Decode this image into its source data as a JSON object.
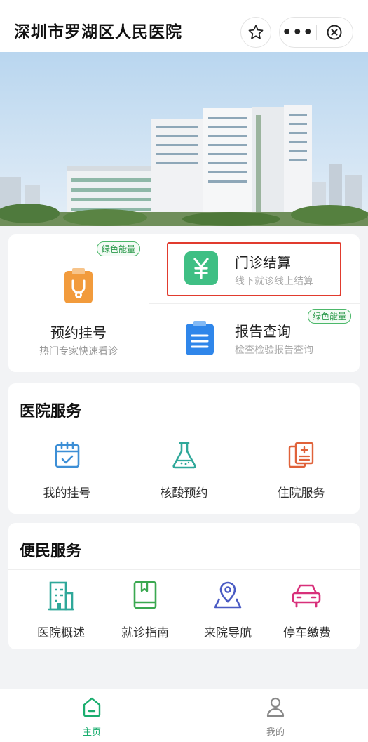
{
  "header": {
    "title": "深圳市罗湖区人民医院",
    "star_icon": "star-icon",
    "more_label": "•••",
    "close_icon": "close-circle-icon"
  },
  "top_card": {
    "appointment": {
      "label": "预约挂号",
      "sub": "热门专家快速看诊",
      "tag": "绿色能量",
      "icon": "clipboard-stethoscope-icon"
    },
    "payment": {
      "label": "门诊结算",
      "sub": "线下就诊线上结算",
      "icon": "yen-icon"
    },
    "report": {
      "label": "报告查询",
      "sub": "检查检验报告查询",
      "tag": "绿色能量",
      "icon": "report-list-icon"
    }
  },
  "hospital_services": {
    "title": "医院服务",
    "items": [
      {
        "label": "我的挂号",
        "icon": "calendar-check-icon"
      },
      {
        "label": "核酸预约",
        "icon": "flask-icon"
      },
      {
        "label": "住院服务",
        "icon": "medical-record-icon"
      }
    ]
  },
  "convenience_services": {
    "title": "便民服务",
    "items": [
      {
        "label": "医院概述",
        "icon": "building-icon"
      },
      {
        "label": "就诊指南",
        "icon": "guide-book-icon"
      },
      {
        "label": "来院导航",
        "icon": "map-pin-icon"
      },
      {
        "label": "停车缴费",
        "icon": "car-icon"
      }
    ]
  },
  "tabbar": {
    "tabs": [
      {
        "label": "主页",
        "icon": "home-icon",
        "active": true
      },
      {
        "label": "我的",
        "icon": "user-icon",
        "active": false
      }
    ]
  },
  "colors": {
    "active_tab": "#1aad6e",
    "inactive_tab": "#888888",
    "highlight_border": "#e13b2e",
    "green_tag": "#4cb86a"
  }
}
